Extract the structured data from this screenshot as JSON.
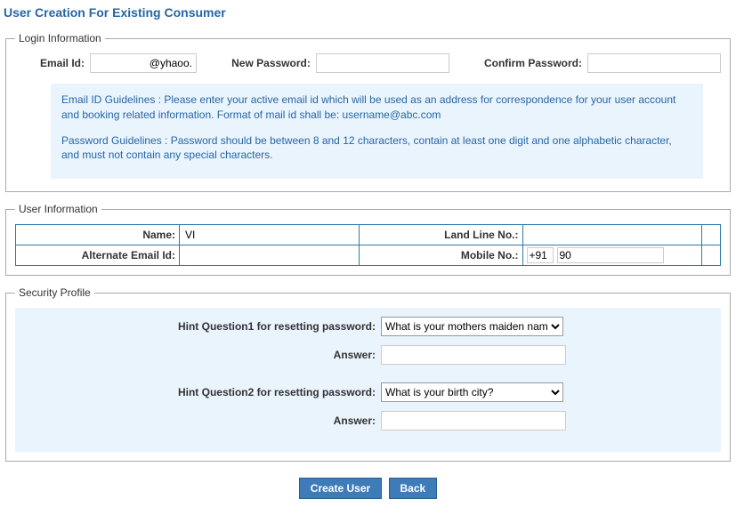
{
  "page_title": "User Creation For Existing Consumer",
  "login": {
    "legend": "Login Information",
    "email_label": "Email Id:",
    "email_value": "@yhaoo.",
    "new_pw_label": "New Password:",
    "new_pw_value": "",
    "confirm_pw_label": "Confirm Password:",
    "confirm_pw_value": "",
    "guideline_email": "Email ID Guidelines : Please enter your active email id which will be used as an address for correspondence for your user account and booking related information. Format of mail id shall be: username@abc.com",
    "guideline_password": "Password Guidelines : Password should be between 8 and 12 characters, contain at least one digit and one alphabetic character, and must not contain any special characters."
  },
  "user": {
    "legend": "User Information",
    "name_label": "Name:",
    "name_value": "VI",
    "landline_label": "Land Line No.:",
    "landline_value": "",
    "altemail_label": "Alternate Email Id:",
    "altemail_value": "",
    "mobile_label": "Mobile No.:",
    "mobile_cc": "+91",
    "mobile_num": "90"
  },
  "security": {
    "legend": "Security Profile",
    "q1_label": "Hint Question1 for resetting password:",
    "q1_value": "What is your mothers maiden name",
    "a_label": "Answer:",
    "a1_value": "",
    "q2_label": "Hint Question2 for resetting password:",
    "q2_value": "What is your birth city?",
    "a2_value": ""
  },
  "buttons": {
    "create": "Create User",
    "back": "Back"
  }
}
